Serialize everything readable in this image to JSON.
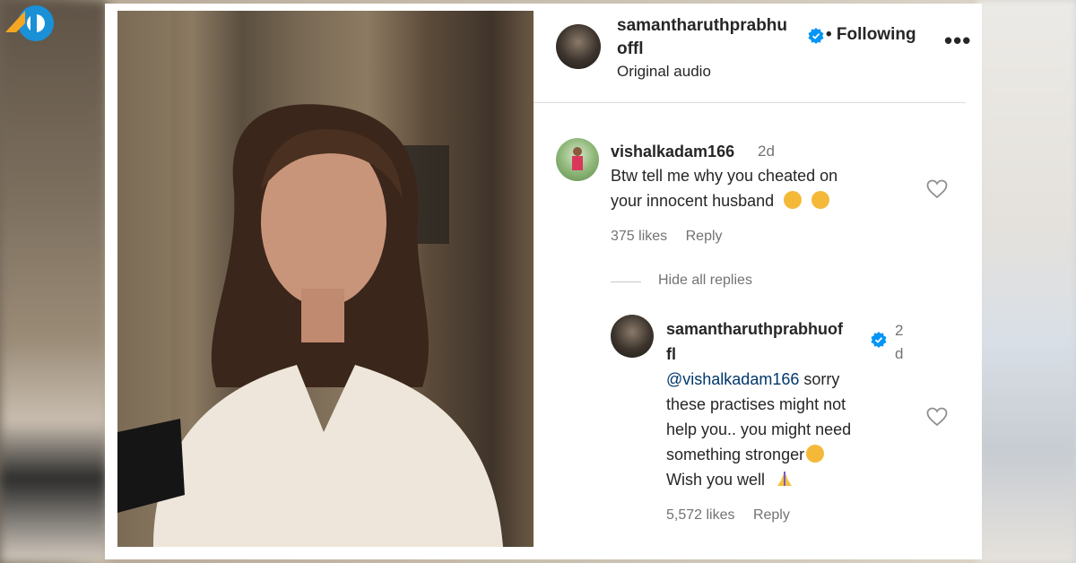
{
  "post": {
    "username": "samantharuthprabhuoffl",
    "username_line1": "samantharuthprabhu",
    "username_line2": "offl",
    "follow_status": "• Following",
    "audio": "Original audio",
    "more_icon": "more-dots-icon"
  },
  "comment": {
    "username": "vishalkadam166",
    "time": "2d",
    "text_line1": "Btw tell me why you cheated on",
    "text_line2": "your innocent husband",
    "emoji": "flushed-face",
    "likes": "375 likes",
    "reply_label": "Reply",
    "hide_replies": "Hide all replies"
  },
  "reply": {
    "username_line1": "samantharuthprabhuof",
    "username_line2": "fl",
    "time_line1": "2",
    "time_line2": "d",
    "mention": "@vishalkadam166",
    "text_line1_rest": " sorry",
    "text_line2": "these practises might not",
    "text_line3": "help you.. you might need",
    "text_line4": "something stronger",
    "text_line5": "Wish you well",
    "emoji_smile": "smiling-face",
    "emoji_pray": "folded-hands",
    "likes": "5,572 likes",
    "reply_label": "Reply"
  },
  "colors": {
    "verified_blue": "#0095f6",
    "text": "#262626",
    "muted": "#737373"
  }
}
